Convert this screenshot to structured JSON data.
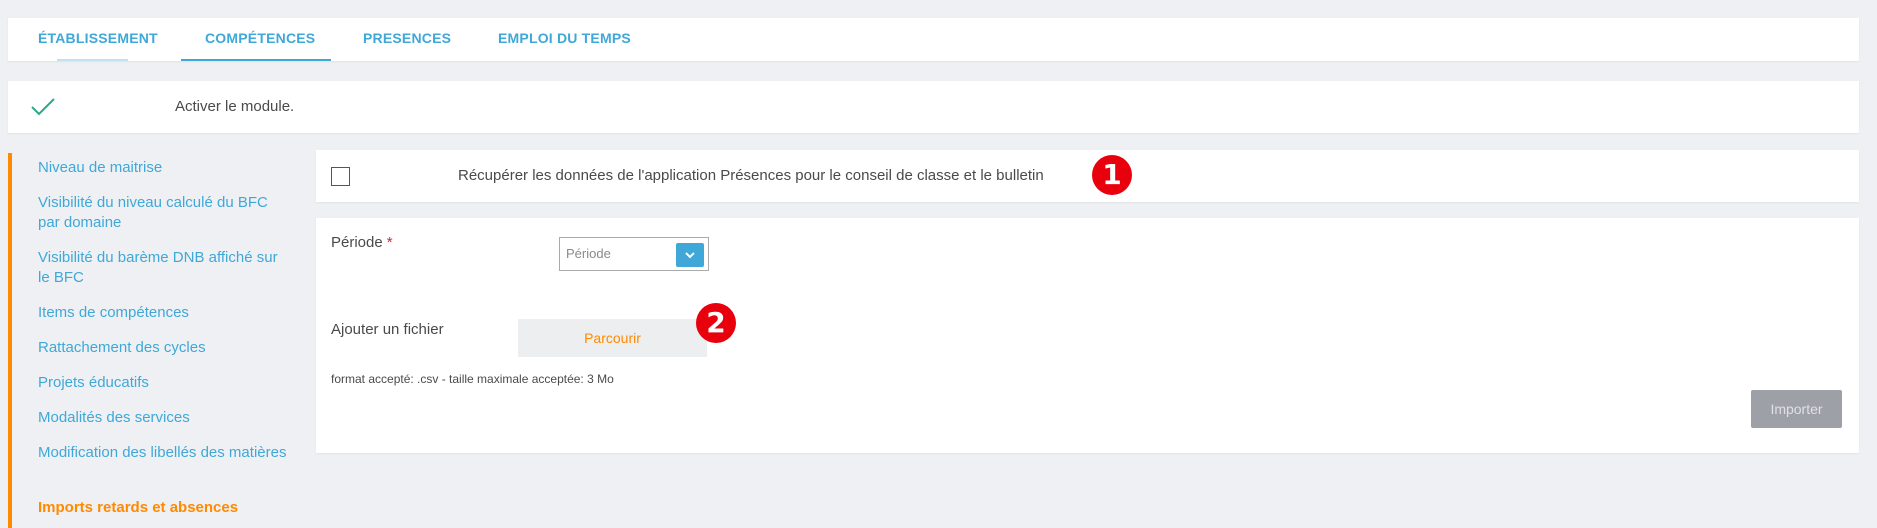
{
  "tabs": [
    {
      "label": "ÉTABLISSEMENT"
    },
    {
      "label": "COMPÉTENCES"
    },
    {
      "label": "PRESENCES"
    },
    {
      "label": "EMPLOI DU TEMPS"
    }
  ],
  "module": {
    "activate_label": "Activer le module."
  },
  "nav": {
    "items": [
      {
        "label": "Niveau de maitrise"
      },
      {
        "label": "Visibilité du niveau calculé du BFC par domaine"
      },
      {
        "label": "Visibilité du barème DNB affiché sur le BFC"
      },
      {
        "label": "Items de compétences"
      },
      {
        "label": "Rattachement des cycles"
      },
      {
        "label": "Projets éducatifs"
      },
      {
        "label": "Modalités des services"
      },
      {
        "label": "Modification des libellés des matières"
      },
      {
        "label": "Imports retards et absences"
      }
    ]
  },
  "presences": {
    "checkbox_label": "Récupérer les données de l'application Présences pour le conseil de classe et le bulletin"
  },
  "import_form": {
    "periode_label": "Période",
    "required_mark": "*",
    "periode_placeholder": "Période",
    "file_label": "Ajouter un fichier",
    "browse_label": "Parcourir",
    "format_note": "format accepté: .csv - taille maximale acceptée: 3 Mo",
    "import_label": "Importer"
  },
  "markers": [
    "1",
    "2"
  ],
  "colors": {
    "accent_blue": "#3fa8d8",
    "accent_orange": "#ff8a00",
    "check_green": "#2aa889",
    "marker_red": "#e8000d"
  }
}
